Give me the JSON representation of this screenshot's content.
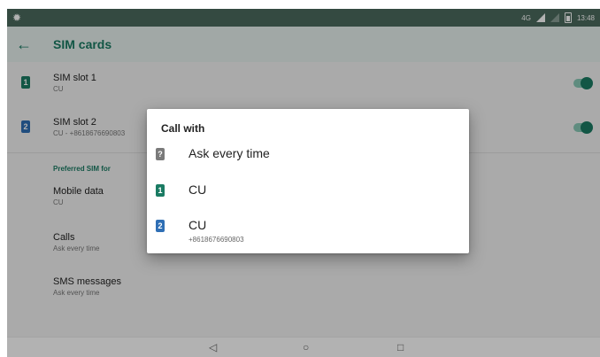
{
  "statusbar": {
    "network": "4G",
    "time": "13:48"
  },
  "appbar": {
    "title": "SIM cards"
  },
  "sim_slots": [
    {
      "label": "SIM slot 1",
      "sub": "CU",
      "badge": "1",
      "color": "#1a7b63"
    },
    {
      "label": "SIM slot 2",
      "sub": "CU - +8618676690803",
      "badge": "2",
      "color": "#2f6fb5"
    }
  ],
  "preferred": {
    "section": "Preferred SIM for",
    "items": [
      {
        "label": "Mobile data",
        "value": "CU"
      },
      {
        "label": "Calls",
        "value": "Ask every time"
      },
      {
        "label": "SMS messages",
        "value": "Ask every time"
      }
    ]
  },
  "dialog": {
    "title": "Call with",
    "options": [
      {
        "label": "Ask every time",
        "sub": "",
        "badge": "?",
        "color": "#7a7a7a"
      },
      {
        "label": "CU",
        "sub": "",
        "badge": "1",
        "color": "#1a7b63"
      },
      {
        "label": "CU",
        "sub": "+8618676690803",
        "badge": "2",
        "color": "#2f6fb5"
      }
    ]
  },
  "navbar": {
    "back": "◁",
    "home": "○",
    "recents": "□"
  }
}
